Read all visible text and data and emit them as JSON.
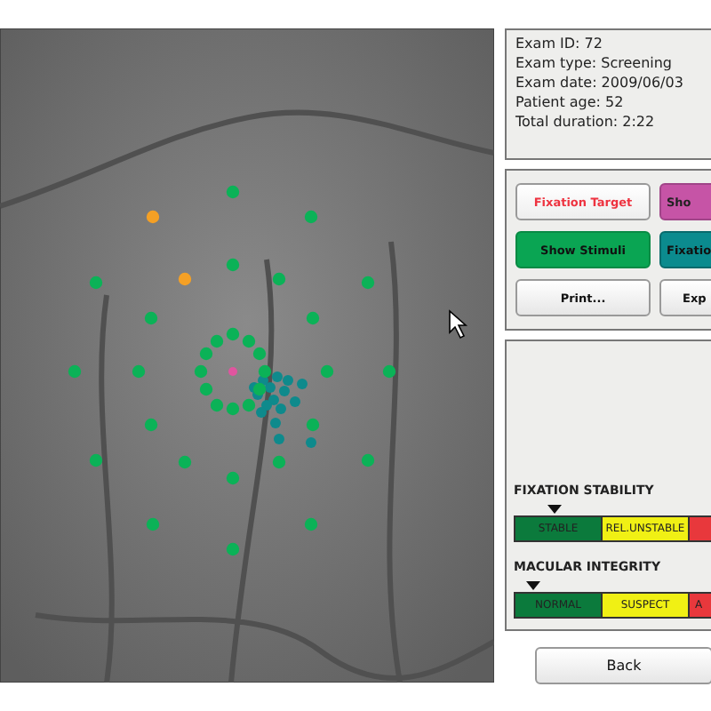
{
  "exam_info": [
    "Exam ID: 72",
    "Exam type: Screening",
    "Exam date: 2009/06/03",
    "Patient age: 52",
    "Total duration: 2:22"
  ],
  "buttons": [
    {
      "label": "Fixation Target",
      "kind": "outline-red"
    },
    {
      "label": "Sho",
      "kind": "pink"
    },
    {
      "label": "Show Stimuli",
      "kind": "green"
    },
    {
      "label": "Fixatio",
      "kind": "teal"
    },
    {
      "label": "Print...",
      "kind": "plain"
    },
    {
      "label": "Exp",
      "kind": "plain"
    }
  ],
  "scales": [
    {
      "title": "FIXATION STABILITY",
      "level": 0.15,
      "segments": [
        {
          "label": "STABLE",
          "color": "#0b7a3c"
        },
        {
          "label": "REL.UNSTABLE",
          "color": "#f0f014"
        },
        {
          "color": "#e8383c"
        }
      ]
    },
    {
      "title": "MACULAR INTEGRITY",
      "level": 0.07,
      "segments": [
        {
          "label": "NORMAL",
          "color": "#0b7a3c"
        },
        {
          "label": "SUSPECT",
          "color": "#f0f014"
        },
        {
          "label": "A",
          "color": "#e8383c"
        }
      ]
    }
  ],
  "back_button": "Back"
}
